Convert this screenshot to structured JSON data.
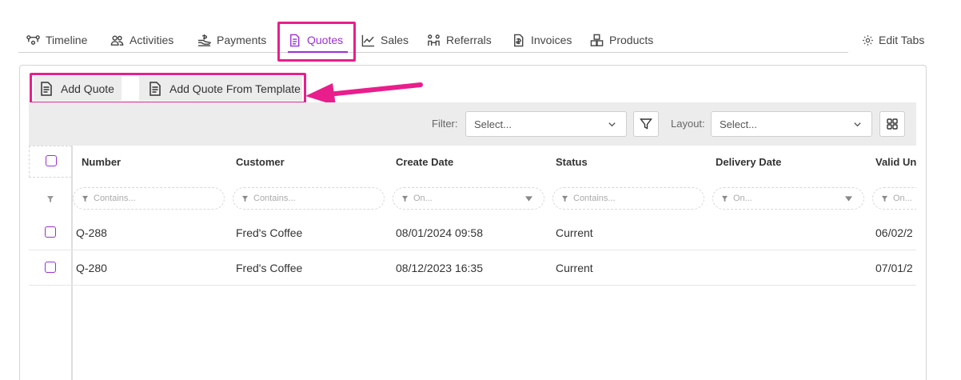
{
  "tabs": [
    {
      "label": "Timeline",
      "icon": "timeline-icon",
      "active": false
    },
    {
      "label": "Activities",
      "icon": "users-icon",
      "active": false
    },
    {
      "label": "Payments",
      "icon": "payment-hand-icon",
      "active": false
    },
    {
      "label": "Quotes",
      "icon": "document-icon",
      "active": true
    },
    {
      "label": "Sales",
      "icon": "line-chart-icon",
      "active": false
    },
    {
      "label": "Referrals",
      "icon": "referral-icon",
      "active": false
    },
    {
      "label": "Invoices",
      "icon": "invoice-icon",
      "active": false
    },
    {
      "label": "Products",
      "icon": "boxes-icon",
      "active": false
    }
  ],
  "edit_tabs_label": "Edit Tabs",
  "actions": {
    "add_quote": "Add Quote",
    "add_quote_from_template": "Add Quote From Template"
  },
  "toolbar": {
    "filter_label": "Filter:",
    "filter_placeholder": "Select...",
    "layout_label": "Layout:",
    "layout_placeholder": "Select..."
  },
  "table": {
    "columns": [
      "Number",
      "Customer",
      "Create Date",
      "Status",
      "Delivery Date",
      "Valid Un"
    ],
    "filters": [
      "Contains...",
      "Contains...",
      "On...",
      "Contains...",
      "On...",
      "On..."
    ],
    "rows": [
      {
        "number": "Q-288",
        "customer": "Fred's Coffee",
        "create_date": "08/01/2024 09:58",
        "status": "Current",
        "delivery_date": "",
        "valid_until": "06/02/2"
      },
      {
        "number": "Q-280",
        "customer": "Fred's Coffee",
        "create_date": "08/12/2023 16:35",
        "status": "Current",
        "delivery_date": "",
        "valid_until": "07/01/2"
      }
    ]
  },
  "colors": {
    "accent": "#9b30d9",
    "highlight": "#e91e8c",
    "toolbar_bg": "#ececec"
  }
}
